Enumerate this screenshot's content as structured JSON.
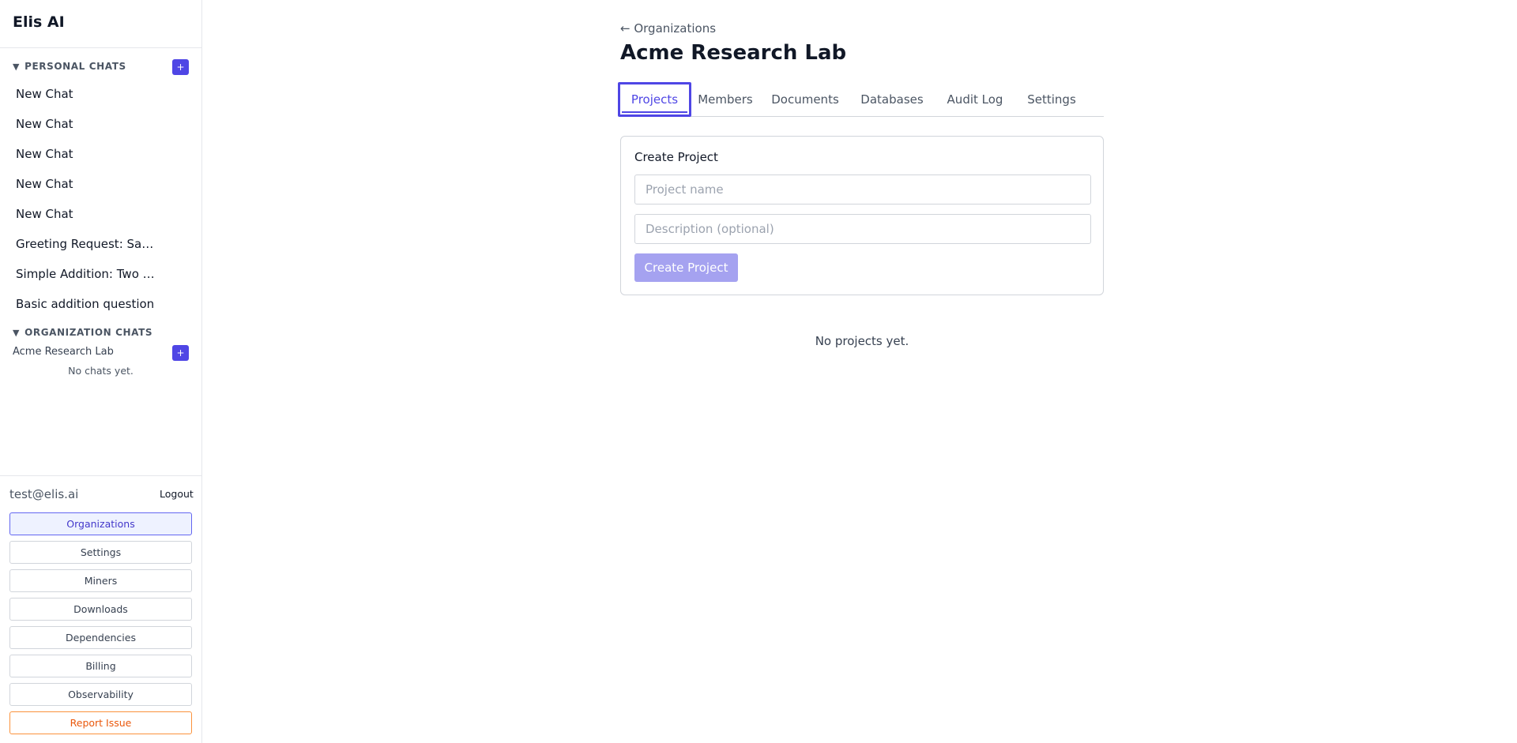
{
  "app": {
    "title": "Elis AI"
  },
  "sidebar": {
    "personal_header": "PERSONAL CHATS",
    "org_header": "ORGANIZATION CHATS",
    "add_label": "+",
    "caret": "▼",
    "personal_chats": [
      "New Chat",
      "New Chat",
      "New Chat",
      "New Chat",
      "New Chat",
      "Greeting Request: Say …",
      "Simple Addition: Two Pl…",
      "Basic addition question"
    ],
    "org_name": "Acme Research Lab",
    "org_empty": "No chats yet.",
    "user_email": "test@elis.ai",
    "logout_label": "Logout",
    "nav_buttons": [
      "Organizations",
      "Settings",
      "Miners",
      "Downloads",
      "Dependencies",
      "Billing",
      "Observability",
      "Report Issue"
    ]
  },
  "main": {
    "back_link": "← Organizations",
    "title": "Acme Research Lab",
    "tabs": [
      "Projects",
      "Members",
      "Documents",
      "Databases",
      "Audit Log",
      "Settings"
    ],
    "active_tab": "Projects",
    "create_card": {
      "title": "Create Project",
      "name_placeholder": "Project name",
      "description_placeholder": "Description (optional)",
      "button_label": "Create Project"
    },
    "empty_state": "No projects yet."
  },
  "colors": {
    "accent": "#4f46e5",
    "accent_disabled": "#a5a2f0",
    "report": "#ea580c"
  }
}
